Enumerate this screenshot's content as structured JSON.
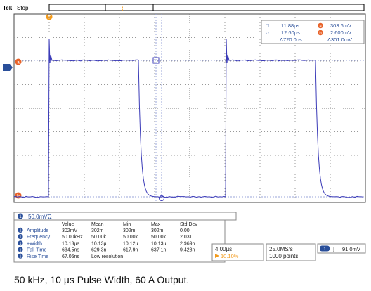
{
  "header": {
    "brand": "Tek",
    "run_state": "Stop"
  },
  "markers": {
    "trigger_pos": "T",
    "ch_a": "a",
    "ch_b": "b"
  },
  "cursors": {
    "row1": {
      "symbol": "□",
      "time": "11.88µs",
      "ch_badge": "a",
      "value": "303.6mV"
    },
    "row2": {
      "symbol": "○",
      "time": "12.60µs",
      "ch_badge": "b",
      "value": "2.600mV"
    },
    "row3": {
      "delta_time": "Δ720.0ns",
      "delta_value": "Δ301.0mV"
    }
  },
  "channel": {
    "badge": "1",
    "scale": "50.0mVΩ"
  },
  "measurements": {
    "headers": [
      "Value",
      "Mean",
      "Min",
      "Max",
      "Std Dev"
    ],
    "rows": [
      {
        "name": "Amplitude",
        "value": "302mV",
        "mean": "302m",
        "min": "302m",
        "max": "302m",
        "std": "0.00"
      },
      {
        "name": "Frequency",
        "value": "50.00kHz",
        "mean": "50.00k",
        "min": "50.00k",
        "max": "50.00k",
        "std": "2.031"
      },
      {
        "name": "+Width",
        "value": "10.13µs",
        "mean": "10.13µ",
        "min": "10.12µ",
        "max": "10.13µ",
        "std": "2.969n"
      },
      {
        "name": "Fall Time",
        "value": "634.5ns",
        "mean": "629.3n",
        "min": "617.9n",
        "max": "637.1n",
        "std": "9.428n"
      },
      {
        "name": "Rise Time",
        "value": "67.05ns",
        "mean": "Low resolution",
        "min": "",
        "max": "",
        "std": ""
      }
    ]
  },
  "horizontal": {
    "scale": "4.00µs",
    "position": "10.10%"
  },
  "acquisition": {
    "rate": "25.0MS/s",
    "points": "1000 points"
  },
  "trigger": {
    "badge": "1",
    "slope_symbol": "∫",
    "level": "91.0mV"
  },
  "caption": "50 kHz, 10 µs Pulse Width, 60 A Output.",
  "colors": {
    "trace": "#3b3bb8",
    "accent_orange": "#f39a1a",
    "cursor_orange": "#e8632a",
    "badge_blue": "#2a4f9a"
  }
}
